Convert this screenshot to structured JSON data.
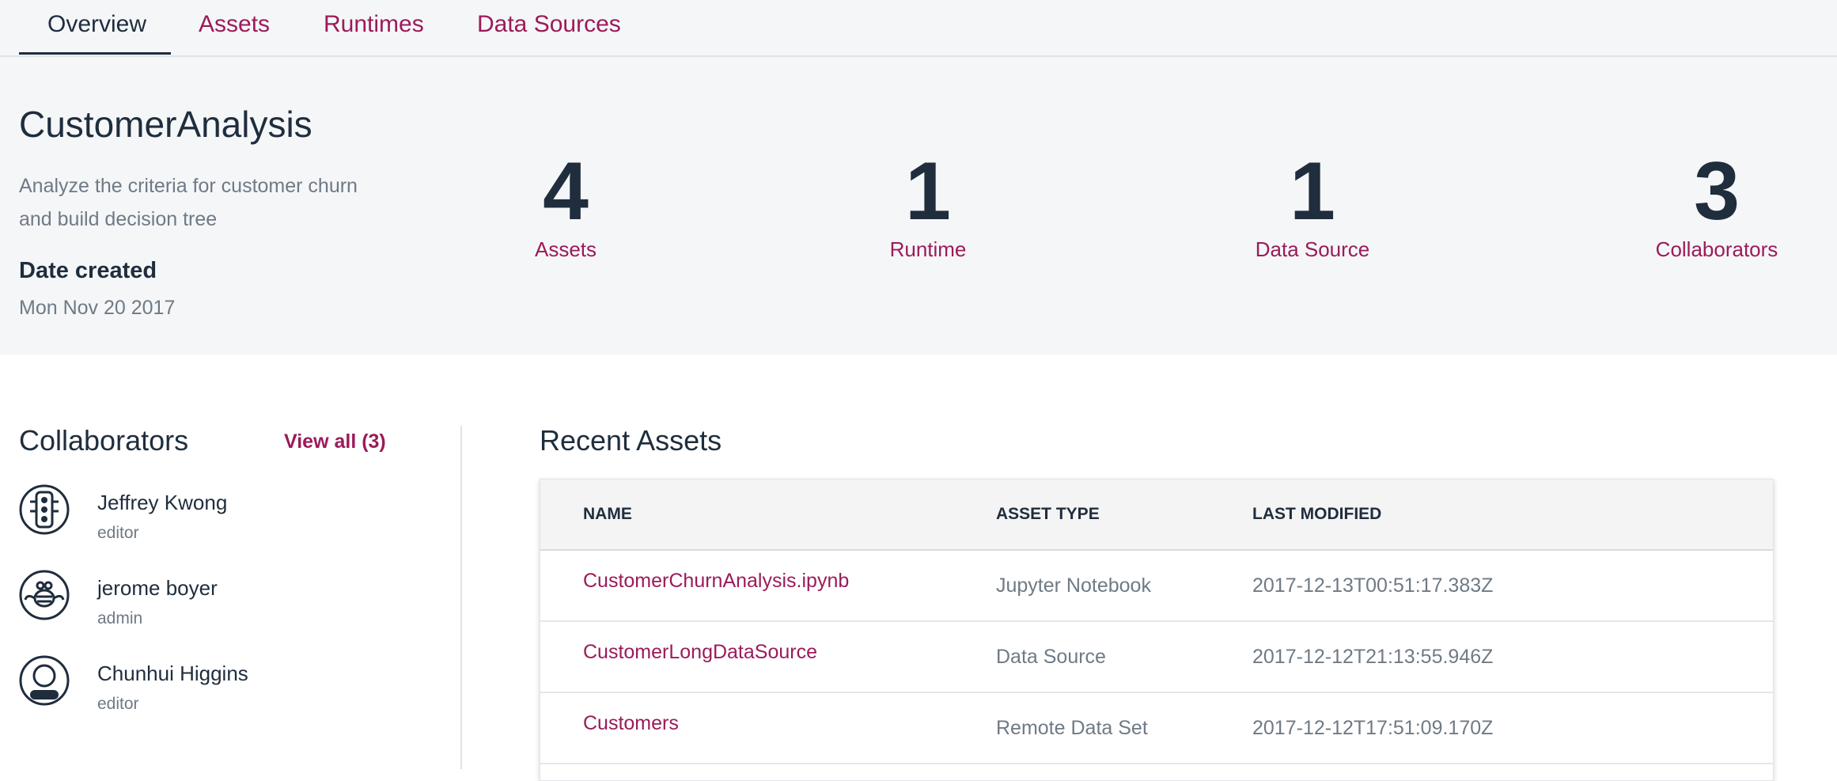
{
  "tabs": [
    {
      "label": "Overview"
    },
    {
      "label": "Assets"
    },
    {
      "label": "Runtimes"
    },
    {
      "label": "Data Sources"
    }
  ],
  "project": {
    "title": "CustomerAnalysis",
    "description": "Analyze the criteria for customer churn and build decision tree",
    "date_label": "Date created",
    "date_value": "Mon Nov 20 2017"
  },
  "stats": [
    {
      "value": "4",
      "label": "Assets"
    },
    {
      "value": "1",
      "label": "Runtime"
    },
    {
      "value": "1",
      "label": "Data Source"
    },
    {
      "value": "3",
      "label": "Collaborators"
    }
  ],
  "collaborators": {
    "title": "Collaborators",
    "view_all": "View all (3)",
    "items": [
      {
        "name": "Jeffrey Kwong",
        "role": "editor",
        "icon": "traffic-light-avatar-icon"
      },
      {
        "name": "jerome boyer",
        "role": "admin",
        "icon": "bee-avatar-icon"
      },
      {
        "name": "Chunhui Higgins",
        "role": "editor",
        "icon": "person-avatar-icon"
      }
    ]
  },
  "recent_assets": {
    "title": "Recent Assets",
    "columns": [
      "NAME",
      "ASSET TYPE",
      "LAST MODIFIED"
    ],
    "rows": [
      {
        "name": "CustomerChurnAnalysis.ipynb",
        "type": "Jupyter Notebook",
        "modified": "2017-12-13T00:51:17.383Z"
      },
      {
        "name": "CustomerLongDataSource",
        "type": "Data Source",
        "modified": "2017-12-12T21:13:55.946Z"
      },
      {
        "name": "Customers",
        "type": "Remote Data Set",
        "modified": "2017-12-12T17:51:09.170Z"
      }
    ]
  },
  "colors": {
    "accent": "#9b1b5a",
    "text_dark": "#1f2d3d",
    "text_muted": "#6f7a85",
    "band_bg": "#f5f6f8"
  }
}
